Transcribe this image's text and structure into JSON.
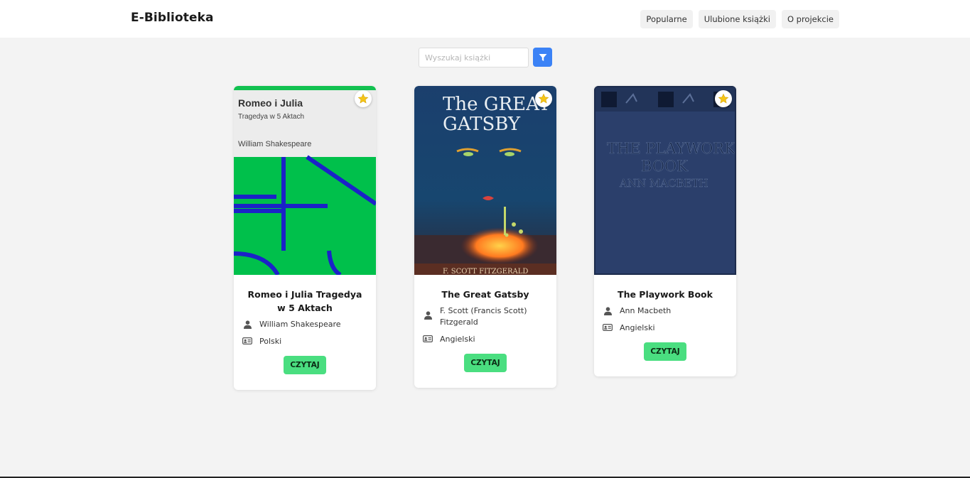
{
  "brand": "E-Biblioteka",
  "nav": {
    "popular": "Popularne",
    "favorites": "Ulubione książki",
    "about": "O projekcie"
  },
  "search": {
    "placeholder": "Wyszukaj książki",
    "value": ""
  },
  "icons": {
    "filter": "filter-funnel-icon",
    "favorite": "star-icon",
    "author": "user-icon",
    "language": "id-card-icon"
  },
  "colors": {
    "accent": "#3b82f6",
    "read_button": "#4ade80",
    "star": "#f5c518"
  },
  "books": [
    {
      "title": "Romeo i Julia Tragedya w 5 Aktach",
      "author": "William Shakespeare",
      "language": "Polski",
      "read_label": "CZYTAJ",
      "cover": {
        "title": "Romeo i Julia",
        "subtitle": "Tragedya w 5 Aktach",
        "author": "William Shakespeare"
      }
    },
    {
      "title": "The Great Gatsby",
      "author": "F. Scott (Francis Scott) Fitzgerald",
      "language": "Angielski",
      "read_label": "CZYTAJ",
      "cover": {
        "title_line1": "The GREAT",
        "title_line2": "GATSBY",
        "author": "F. SCOTT FITZGERALD"
      }
    },
    {
      "title": "The Playwork Book",
      "author": "Ann Macbeth",
      "language": "Angielski",
      "read_label": "CZYTAJ",
      "cover": {
        "title_line1": "THE PLAYWORK",
        "title_line2": "BOOK",
        "author": "ANN MACBETH"
      }
    }
  ]
}
